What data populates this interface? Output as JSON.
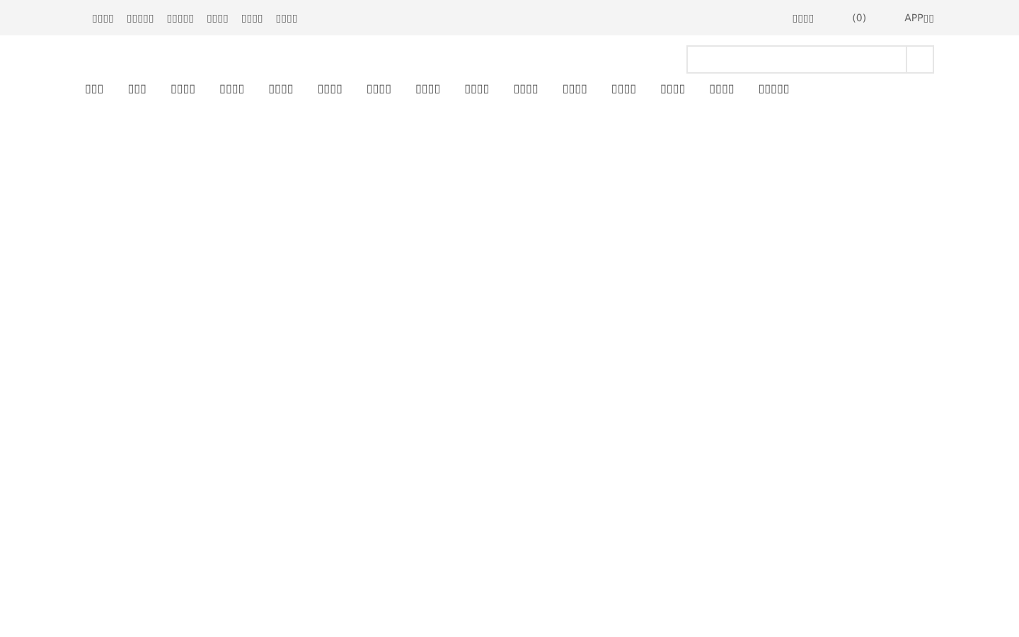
{
  "top_bar": {
    "left_links": [
      "▯▯▯▯",
      "▯▯▯▯▯",
      "▯▯▯▯▯",
      "▯▯▯▯",
      "▯▯▯▯",
      "▯▯▯▯"
    ],
    "right_links": [
      "▯▯▯▯",
      "(0)",
      "APP▯▯"
    ]
  },
  "nav": [
    "▯▯▯",
    "▯▯▯",
    "▯▯▯▯",
    "▯▯▯▯",
    "▯▯▯▯",
    "▯▯▯▯",
    "▯▯▯▯",
    "▯▯▯▯",
    "▯▯▯▯",
    "▯▯▯▯",
    "▯▯▯▯",
    "▯▯▯▯",
    "▯▯▯▯",
    "▯▯▯▯",
    "▯▯▯▯▯"
  ]
}
